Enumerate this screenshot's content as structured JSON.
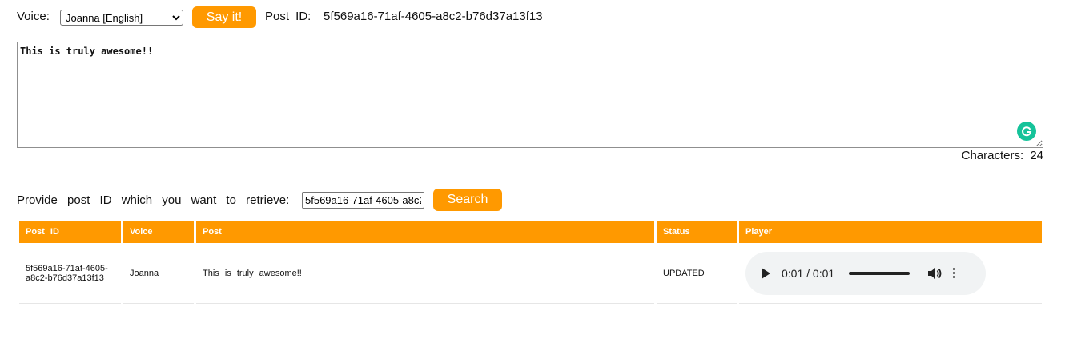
{
  "top_bar": {
    "voice_label": "Voice:",
    "voice_selected": "Joanna [English]",
    "say_button": "Say it!",
    "post_id_label": "Post ID:",
    "post_id_value": "5f569a16-71af-4605-a8c2-b76d37a13f13"
  },
  "editor": {
    "text": "This is truly awesome!!",
    "grammarly_icon": "grammarly-icon",
    "characters_label": "Characters:",
    "characters_count": "24"
  },
  "retrieve": {
    "label": "Provide post ID which you want to retrieve:",
    "input_value": "5f569a16-71af-4605-a8c2-b76d37a13f13",
    "search_button": "Search"
  },
  "table": {
    "headers": [
      "Post ID",
      "Voice",
      "Post",
      "Status",
      "Player"
    ],
    "rows": [
      {
        "post_id": "5f569a16-71af-4605-a8c2-b76d37a13f13",
        "voice": "Joanna",
        "post": "This is truly awesome!!",
        "status": "UPDATED",
        "player": {
          "time": "0:01 / 0:01"
        }
      }
    ]
  },
  "colors": {
    "accent": "#ff9900",
    "grammarly": "#15c39a",
    "player_bg": "#f1f3f4"
  }
}
